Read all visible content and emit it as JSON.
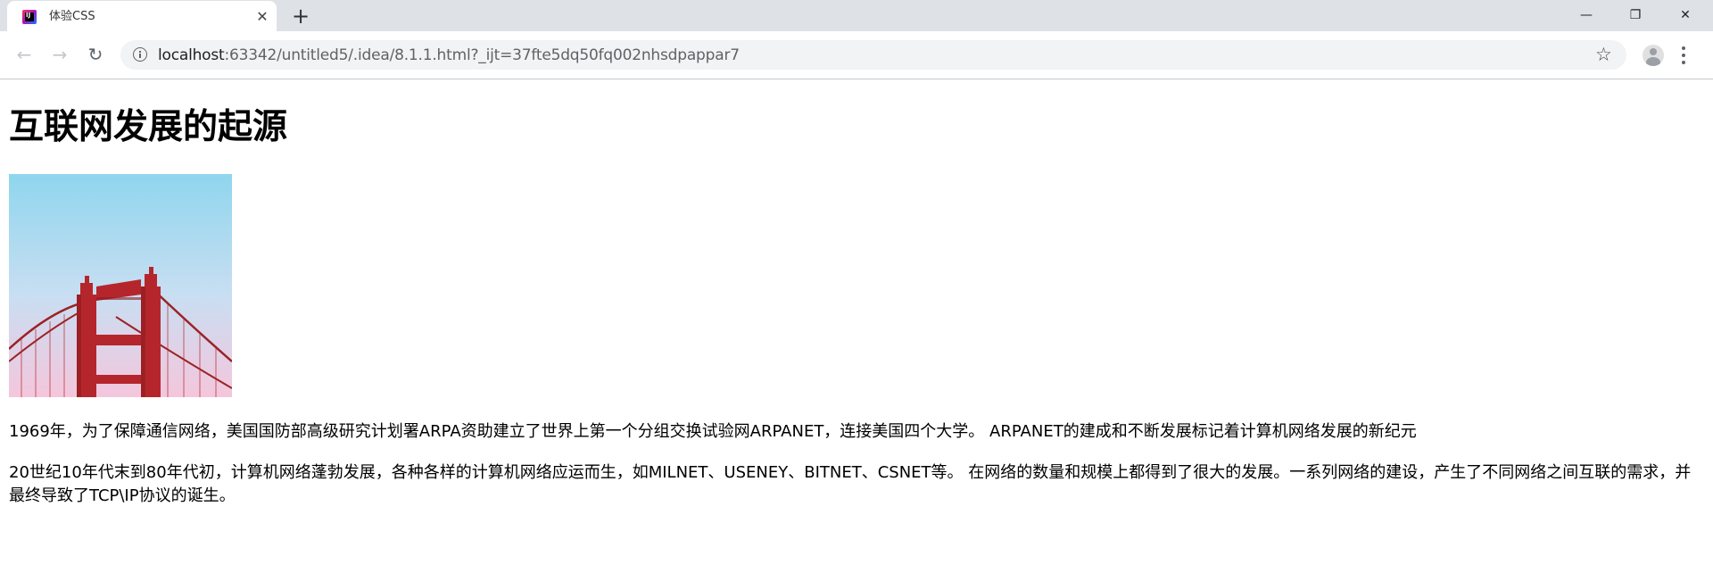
{
  "browser": {
    "tab_title": "体验CSS",
    "tab_close_glyph": "✕",
    "new_tab_glyph": "+",
    "url_host": "localhost",
    "url_path": ":63342/untitled5/.idea/8.1.1.html?_ijt=37fte5dq50fq002nhsdpappar7",
    "favicon_label": "IJ",
    "window_controls": {
      "minimize": "—",
      "restore": "❐",
      "close": "✕"
    },
    "nav": {
      "back": "←",
      "forward": "→",
      "reload": "↻"
    },
    "star": "☆"
  },
  "page": {
    "heading": "互联网发展的起源",
    "image_subject": "golden-gate-bridge-tower",
    "paragraphs": [
      "1969年，为了保障通信网络，美国国防部高级研究计划署ARPA资助建立了世界上第一个分组交换试验网ARPANET，连接美国四个大学。 ARPANET的建成和不断发展标记着计算机网络发展的新纪元",
      "20世纪10年代末到80年代初，计算机网络蓬勃发展，各种各样的计算机网络应运而生，如MILNET、USENEY、BITNET、CSNET等。 在网络的数量和规模上都得到了很大的发展。一系列网络的建设，产生了不同网络之间互联的需求，并最终导致了TCP\\IP协议的诞生。"
    ]
  },
  "colors": {
    "tabstrip": "#dee1e6",
    "omnibox": "#f1f3f4",
    "bridge_red": "#b5262c",
    "sky_top": "#8fd6ee",
    "sky_bottom": "#f4c6dc"
  }
}
